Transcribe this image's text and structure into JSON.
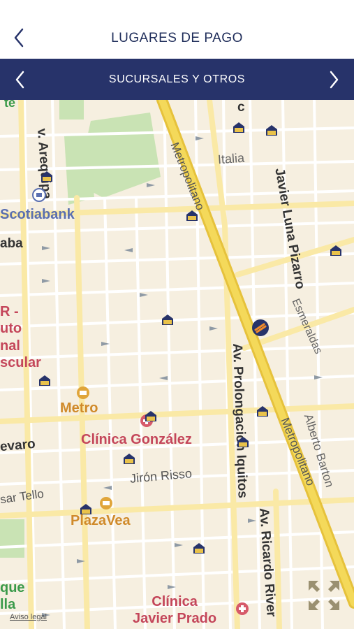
{
  "header": {
    "title": "LUGARES DE PAGO"
  },
  "subheader": {
    "title": "SUCURSALES Y OTROS"
  },
  "map": {
    "legal": "Aviso legal",
    "streets": {
      "arequipa": "v. Arequipa",
      "metropolitano_1": "Metropolitano",
      "metropolitano_2": "Metropolitano",
      "italia": "Italia",
      "luna_pizarro": "Javier Luna Pizarro",
      "esmeraldas": "Esmeraldas",
      "prolongacion": "Av. Prolongación Iquitos",
      "alberto_barton": "Alberto Barton",
      "jiron_risso": "Jirón Risso",
      "sar_tello": "sar Tello",
      "ricardo_rivera": "Av. Ricardo River",
      "evaro": "evaro",
      "aba": "aba",
      "c_top": "c"
    },
    "places": {
      "scotiabank": "Scotiabank",
      "metro": "Metro",
      "plaza_vea": "PlazaVea",
      "clinica_gonzalez": "Clínica González",
      "clinica_javier_prado": "Clínica\nJavier Prado",
      "instituto_1": "R -",
      "instituto_2": "uto",
      "instituto_3": "nal",
      "instituto_4": "scular",
      "parque_1": "que",
      "parque_2": "lla",
      "te": "te"
    },
    "colors": {
      "accent": "#27336a",
      "road_major": "#f1d350",
      "road_minor": "#fae9a6",
      "park": "#c9e3b4"
    }
  }
}
